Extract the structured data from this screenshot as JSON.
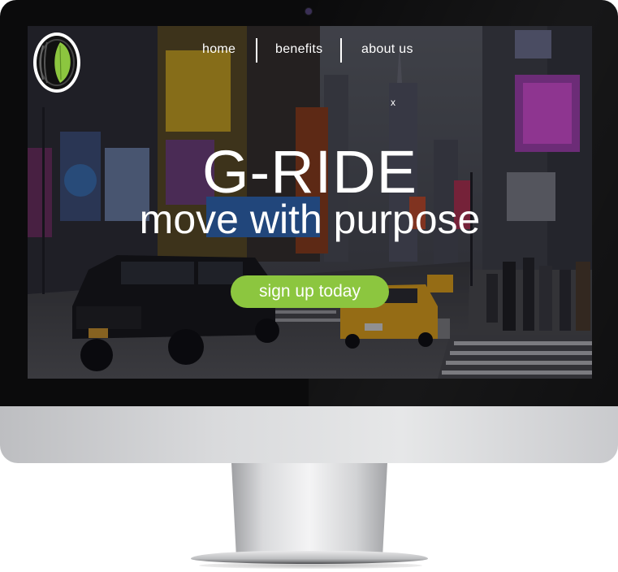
{
  "nav": {
    "items": [
      {
        "label": "home"
      },
      {
        "label": "benefits"
      },
      {
        "label": "about us"
      }
    ]
  },
  "banner": {
    "close_label": "x"
  },
  "hero": {
    "title": "G-RIDE",
    "subtitle": "move with purpose",
    "cta_label": "sign up today"
  },
  "colors": {
    "accent": "#8cc63f",
    "logo_leaf": "#8cc63f",
    "monitor_bezel": "#0b0b0c",
    "monitor_chin": "#d9dadc"
  },
  "icons": {
    "logo": "tire-leaf-logo-icon",
    "camera": "webcam-icon"
  }
}
